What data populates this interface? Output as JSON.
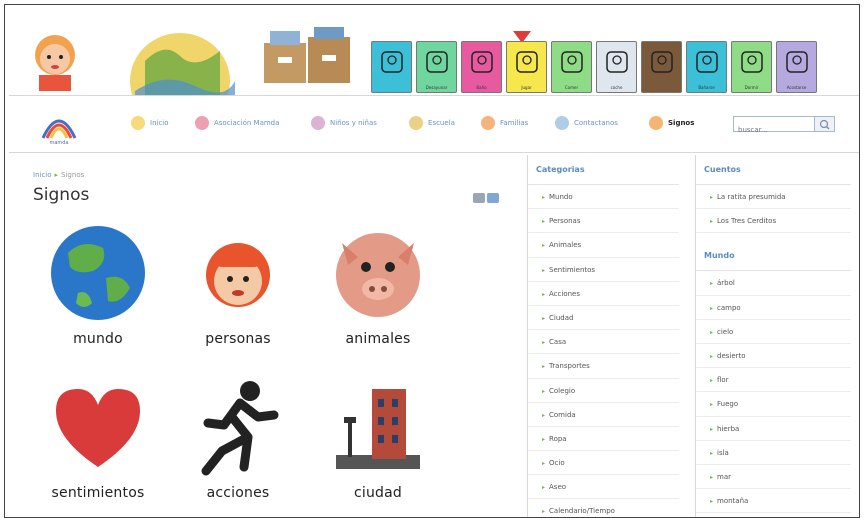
{
  "nav": {
    "items": [
      {
        "label": "Inicio",
        "icon": "sun-icon"
      },
      {
        "label": "Asociación Mamda",
        "icon": "people-icon"
      },
      {
        "label": "Niños y niñas",
        "icon": "children-icon"
      },
      {
        "label": "Escuela",
        "icon": "school-icon"
      },
      {
        "label": "Familias",
        "icon": "family-icon"
      },
      {
        "label": "Contactanos",
        "icon": "contact-icon"
      },
      {
        "label": "Signos",
        "icon": "signs-icon"
      }
    ],
    "active": "Signos",
    "search_placeholder": "buscar..."
  },
  "breadcrumb": {
    "home": "Inicio",
    "sep": "▸",
    "current": "Signos"
  },
  "page_title": "Signos",
  "tiles": [
    {
      "label": "mundo",
      "icon": "globe-icon"
    },
    {
      "label": "personas",
      "icon": "person-icon"
    },
    {
      "label": "animales",
      "icon": "pig-icon"
    },
    {
      "label": "sentimientos",
      "icon": "heart-icon"
    },
    {
      "label": "acciones",
      "icon": "running-man-icon"
    },
    {
      "label": "ciudad",
      "icon": "city-icon"
    }
  ],
  "categories": {
    "title": "Categorias",
    "items": [
      "Mundo",
      "Personas",
      "Animales",
      "Sentimientos",
      "Acciones",
      "Ciudad",
      "Casa",
      "Transportes",
      "Colegio",
      "Comida",
      "Ropa",
      "Ocio",
      "Aseo",
      "Calendario/Tiempo"
    ]
  },
  "cuentos": {
    "title": "Cuentos",
    "items": [
      "La ratita presumida",
      "Los Tres Cerditos"
    ]
  },
  "mundo": {
    "title": "Mundo",
    "items": [
      "árbol",
      "campo",
      "cielo",
      "desierto",
      "flor",
      "Fuego",
      "hierba",
      "isla",
      "mar",
      "montaña"
    ]
  },
  "banner_cards": [
    {
      "color": "#3cc0d8",
      "caption": ""
    },
    {
      "color": "#6fd6a0",
      "caption": "Desayunar"
    },
    {
      "color": "#e85a9f",
      "caption": "Baño"
    },
    {
      "color": "#f6e84c",
      "caption": "Jugar"
    },
    {
      "color": "#8fdc86",
      "caption": "Comer"
    },
    {
      "color": "#dfe6ee",
      "caption": "coche"
    },
    {
      "color": "#7a5a3a",
      "caption": ""
    },
    {
      "color": "#3cc0d8",
      "caption": "Bañarse"
    },
    {
      "color": "#8fdc86",
      "caption": "Dormir"
    },
    {
      "color": "#b6a9e0",
      "caption": "Acostarse"
    }
  ],
  "colors": {
    "link": "#6a93c9",
    "heading": "#5a8bc4",
    "arrow": "#7ab648",
    "active_marker": "#e23a3a"
  }
}
